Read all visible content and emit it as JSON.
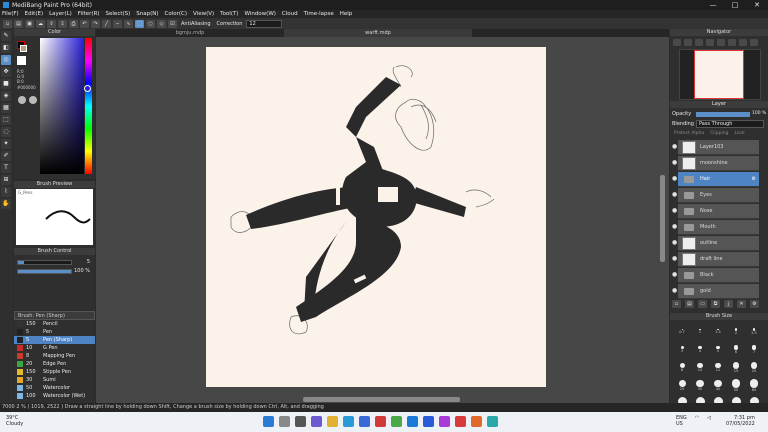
{
  "window": {
    "title": "MediBang Paint Pro (64bit)",
    "controls": [
      "—",
      "□",
      "✕"
    ]
  },
  "menu": [
    "File(F)",
    "Edit(E)",
    "Layer(L)",
    "Filter(R)",
    "Select(S)",
    "Snap(N)",
    "Color(C)",
    "View(V)",
    "Tool(T)",
    "Window(W)",
    "Cloud",
    "Time-lapse",
    "Help"
  ],
  "toolbar": {
    "antialiasing_label": "AntiAliasing",
    "correction_label": "Correction",
    "correction_value": "12"
  },
  "tabs": [
    "bgmju.mdp",
    "warft.mdp",
    ""
  ],
  "color_panel": {
    "title": "Color",
    "r": "R:0",
    "g": "G:0",
    "b": "B:0",
    "hex": "#000000"
  },
  "brush_preview": {
    "title": "Brush Preview",
    "brush_name": "G_Pens"
  },
  "brush_control": {
    "title": "Brush Control",
    "size": "5",
    "opacity": "100 %"
  },
  "brush_list": {
    "header": "Brush: Pen (Sharp)",
    "items": [
      {
        "size": "150",
        "name": "Pencil",
        "color": "#333333"
      },
      {
        "size": "5",
        "name": "Pen",
        "color": "#222222"
      },
      {
        "size": "5",
        "name": "Pen (Sharp)",
        "color": "#222222"
      },
      {
        "size": "10",
        "name": "G Pen",
        "color": "#cc2a2a"
      },
      {
        "size": "8",
        "name": "Mapping Pen",
        "color": "#cc3a2a"
      },
      {
        "size": "20",
        "name": "Edge Pen",
        "color": "#3aa83a"
      },
      {
        "size": "150",
        "name": "Stipple Pen",
        "color": "#e6b82a"
      },
      {
        "size": "30",
        "name": "Sumi",
        "color": "#e6a82a"
      },
      {
        "size": "50",
        "name": "Watercolor",
        "color": "#7ab8e6"
      },
      {
        "size": "100",
        "name": "Watercolor (Wet)",
        "color": "#7ab8e6"
      }
    ]
  },
  "navigator": {
    "title": "Navigator"
  },
  "layer_panel": {
    "title": "Layer",
    "opacity_label": "Opacity",
    "opacity_value": "100 %",
    "blending_label": "Blending",
    "blending_value": "Pass Through",
    "protect_alpha": "Protect Alpha",
    "clipping": "Clipping",
    "lock": "Lock",
    "layers": [
      {
        "name": "Layer103",
        "kind": "layer"
      },
      {
        "name": "moonshine",
        "kind": "layer"
      },
      {
        "name": "Hair",
        "kind": "folder",
        "selected": true
      },
      {
        "name": "Eyes",
        "kind": "folder"
      },
      {
        "name": "Nose",
        "kind": "folder"
      },
      {
        "name": "Mouth",
        "kind": "folder"
      },
      {
        "name": "outline",
        "kind": "layer"
      },
      {
        "name": "draft line",
        "kind": "layer"
      },
      {
        "name": "Black",
        "kind": "folder"
      },
      {
        "name": "gold",
        "kind": "folder"
      }
    ]
  },
  "brush_size": {
    "title": "Brush Size",
    "sizes": [
      "0.7",
      "1",
      "1.5",
      "2",
      "2.5",
      "3",
      "4",
      "5",
      "6",
      "7",
      "8",
      "10",
      "12",
      "15",
      "20",
      "25",
      "30",
      "40",
      "50",
      "60",
      "70",
      "80",
      "100",
      "150",
      "200"
    ]
  },
  "status": {
    "zoom": "7000",
    "text": "2 % ( 1019, 2522 )   Draw a straight line by holding down Shift, Change a brush size by holding down Ctrl, Alt, and dragging"
  },
  "taskbar": {
    "weather_temp": "39°C",
    "weather_desc": "Cloudy",
    "lang": "ENG",
    "region": "US",
    "time": "7:31 pm",
    "date": "07/05/2022"
  },
  "colors": {
    "accent": "#4e83c4",
    "canvas_bg": "#474747",
    "paper": "#fbf3ea"
  }
}
